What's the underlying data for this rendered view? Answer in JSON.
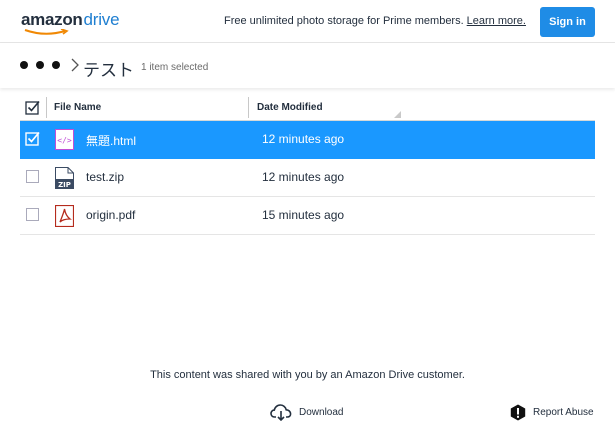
{
  "header": {
    "logo_amazon": "amazon",
    "logo_drive": "drive",
    "promo_text": "Free unlimited photo storage for Prime members.",
    "promo_link": "Learn more.",
    "signin_label": "Sign in"
  },
  "breadcrumb": {
    "title": "テスト",
    "subtitle": "1 item selected"
  },
  "table": {
    "columns": {
      "name": "File Name",
      "date": "Date Modified"
    },
    "rows": [
      {
        "name": "無題.html",
        "modified": "12 minutes ago",
        "icon": "html-file-icon",
        "selected": true
      },
      {
        "name": "test.zip",
        "modified": "12 minutes ago",
        "icon": "zip-file-icon",
        "selected": false
      },
      {
        "name": "origin.pdf",
        "modified": "15 minutes ago",
        "icon": "pdf-file-icon",
        "selected": false
      }
    ]
  },
  "footer": {
    "shared_text": "This content was shared with you by an Amazon Drive customer.",
    "download_label": "Download",
    "report_label": "Report Abuse"
  },
  "colors": {
    "accent": "#1f8ce6",
    "selected_row": "#1a98ff",
    "drive_blue": "#1f7fd1"
  }
}
